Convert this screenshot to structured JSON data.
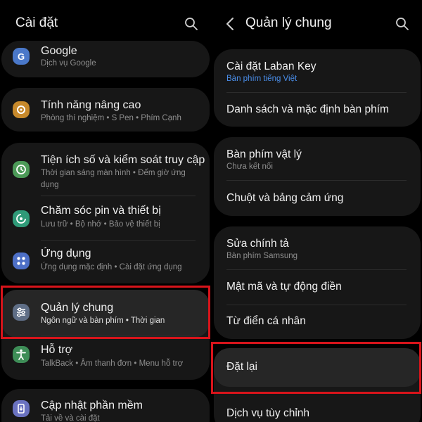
{
  "left": {
    "title": "Cài đặt",
    "items": [
      {
        "title": "Google",
        "sub": "Dịch vụ Google",
        "icon": "google-icon",
        "color": "#4a78c9"
      },
      {
        "title": "Tính năng nâng cao",
        "sub": "Phòng thí nghiệm • S Pen • Phím Cạnh",
        "icon": "advanced-features-icon",
        "color": "#c7892b"
      },
      {
        "title": "Tiện ích số và kiểm soát truy cập",
        "sub": "Thời gian sáng màn hình • Đếm giờ ứng dụng",
        "icon": "digital-wellbeing-icon",
        "color": "#4c9a58"
      },
      {
        "title": "Chăm sóc pin và thiết bị",
        "sub": "Lưu trữ • Bộ nhớ • Bảo vệ thiết bị",
        "icon": "device-care-icon",
        "color": "#2f9a78"
      },
      {
        "title": "Ứng dụng",
        "sub": "Ứng dụng mặc định • Cài đặt ứng dụng",
        "icon": "apps-icon",
        "color": "#4d6fc6"
      },
      {
        "title": "Quản lý chung",
        "sub": "Ngôn ngữ và bàn phím • Thời gian",
        "icon": "general-management-icon",
        "color": "#5f6e86"
      },
      {
        "title": "Hỗ trợ",
        "sub": "TalkBack • Âm thanh đơn • Menu hỗ trợ",
        "icon": "accessibility-icon",
        "color": "#3e8d57"
      },
      {
        "title": "Cập nhật phần mềm",
        "sub": "Tải về và cài đặt",
        "icon": "software-update-icon",
        "color": "#6a72c0"
      }
    ]
  },
  "right": {
    "title": "Quản lý chung",
    "items": [
      {
        "title": "Cài đặt Laban Key",
        "sub": "Bàn phím tiếng Việt"
      },
      {
        "title": "Danh sách và mặc định bàn phím",
        "sub": ""
      },
      {
        "title": "Bàn phím vật lý",
        "sub": "Chưa kết nối"
      },
      {
        "title": "Chuột và bảng cảm ứng",
        "sub": ""
      },
      {
        "title": "Sửa chính tả",
        "sub": "Bàn phím Samsung"
      },
      {
        "title": "Mật mã và tự động điền",
        "sub": ""
      },
      {
        "title": "Từ điển cá nhân",
        "sub": ""
      },
      {
        "title": "Đặt lại",
        "sub": ""
      },
      {
        "title": "Dịch vụ tùy chỉnh",
        "sub": ""
      }
    ]
  },
  "colors": {
    "highlight_box": "#d8141b",
    "accent_text": "#4a8eea",
    "background": "#000000",
    "card": "#171717"
  }
}
